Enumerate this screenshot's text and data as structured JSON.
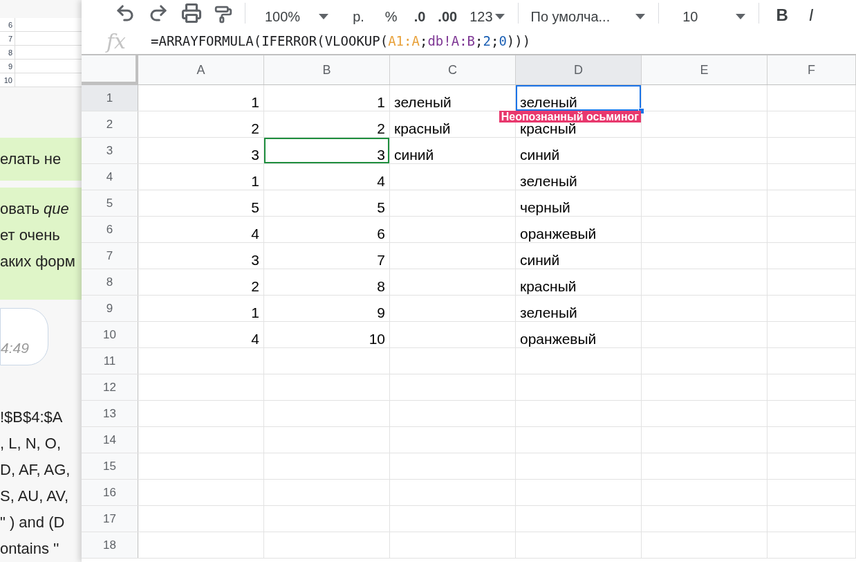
{
  "background_chat": {
    "mini_sheet_rows": [
      "6",
      "7",
      "8",
      "9",
      "10"
    ],
    "messages": [
      {
        "kind": "bubble",
        "lines": [
          "елать не"
        ]
      },
      {
        "kind": "bubble",
        "lines": [
          "овать *que*",
          "ет очень",
          "аких форм"
        ]
      },
      {
        "kind": "time",
        "lines": [
          "4:49"
        ]
      },
      {
        "kind": "plain",
        "lines": [
          "!$B$4:$A",
          ", L, N, O,",
          "D, AF, AG,",
          "S, AU, AV,",
          "\" ) and (D",
          "ontains ''"
        ]
      }
    ]
  },
  "toolbar": {
    "zoom": "100%",
    "currency": "р.",
    "percent": "%",
    "decimal_decrease": ".0",
    "decimal_increase": ".00",
    "number_format": "123",
    "font": "По умолча...",
    "font_size": "10",
    "bold": "B",
    "italic": "I"
  },
  "formula_bar": {
    "function_label": "fx",
    "segments": [
      {
        "text": "=ARRAYFORMULA(IFERROR(VLOOKUP(",
        "color": "#202124"
      },
      {
        "text": "A1:A",
        "color": "#e8a13a"
      },
      {
        "text": ";",
        "color": "#202124"
      },
      {
        "text": "db!A:B",
        "color": "#7e3794"
      },
      {
        "text": ";",
        "color": "#202124"
      },
      {
        "text": "2",
        "color": "#1a5fb4"
      },
      {
        "text": ";",
        "color": "#202124"
      },
      {
        "text": "0",
        "color": "#1a5fb4"
      },
      {
        "text": ")))",
        "color": "#202124"
      }
    ]
  },
  "columns": [
    {
      "label": "A",
      "selected": false,
      "kind": "number"
    },
    {
      "label": "B",
      "selected": false,
      "kind": "number"
    },
    {
      "label": "C",
      "selected": false,
      "kind": "text"
    },
    {
      "label": "D",
      "selected": true,
      "kind": "text"
    },
    {
      "label": "E",
      "selected": false,
      "kind": "text"
    },
    {
      "label": "F",
      "selected": false,
      "kind": "text"
    }
  ],
  "collaborator_label": "Неопознанный осьминог",
  "rows": [
    {
      "label": "1",
      "selected": true,
      "cells": [
        {
          "text": "1",
          "selected": false,
          "peer_cursor": false
        },
        {
          "text": "1",
          "selected": false,
          "peer_cursor": false
        },
        {
          "text": "зеленый",
          "selected": false,
          "peer_cursor": false
        },
        {
          "text": "зеленый",
          "selected": true,
          "peer_cursor": false
        }
      ]
    },
    {
      "label": "2",
      "selected": false,
      "cells": [
        {
          "text": "2",
          "selected": false,
          "peer_cursor": false
        },
        {
          "text": "2",
          "selected": false,
          "peer_cursor": false
        },
        {
          "text": "красный",
          "selected": false,
          "peer_cursor": false
        },
        {
          "text": "красный",
          "selected": false,
          "peer_cursor": false
        }
      ]
    },
    {
      "label": "3",
      "selected": false,
      "cells": [
        {
          "text": "3",
          "selected": false,
          "peer_cursor": false
        },
        {
          "text": "3",
          "selected": false,
          "peer_cursor": true
        },
        {
          "text": "синий",
          "selected": false,
          "peer_cursor": false
        },
        {
          "text": "синий",
          "selected": false,
          "peer_cursor": false
        }
      ]
    },
    {
      "label": "4",
      "selected": false,
      "cells": [
        {
          "text": "1",
          "selected": false,
          "peer_cursor": false
        },
        {
          "text": "4",
          "selected": false,
          "peer_cursor": false
        },
        {
          "selected": false,
          "peer_cursor": false
        },
        {
          "text": "зеленый",
          "selected": false,
          "peer_cursor": false
        }
      ]
    },
    {
      "label": "5",
      "selected": false,
      "cells": [
        {
          "text": "5",
          "selected": false,
          "peer_cursor": false
        },
        {
          "text": "5",
          "selected": false,
          "peer_cursor": false
        },
        {
          "selected": false,
          "peer_cursor": false
        },
        {
          "text": "черный",
          "selected": false,
          "peer_cursor": false
        }
      ]
    },
    {
      "label": "6",
      "selected": false,
      "cells": [
        {
          "text": "4",
          "selected": false,
          "peer_cursor": false
        },
        {
          "text": "6",
          "selected": false,
          "peer_cursor": false
        },
        {
          "selected": false,
          "peer_cursor": false
        },
        {
          "text": "оранжевый",
          "selected": false,
          "peer_cursor": false
        }
      ]
    },
    {
      "label": "7",
      "selected": false,
      "cells": [
        {
          "text": "3",
          "selected": false,
          "peer_cursor": false
        },
        {
          "text": "7",
          "selected": false,
          "peer_cursor": false
        },
        {
          "selected": false,
          "peer_cursor": false
        },
        {
          "text": "синий",
          "selected": false,
          "peer_cursor": false
        }
      ]
    },
    {
      "label": "8",
      "selected": false,
      "cells": [
        {
          "text": "2",
          "selected": false,
          "peer_cursor": false
        },
        {
          "text": "8",
          "selected": false,
          "peer_cursor": false
        },
        {
          "selected": false,
          "peer_cursor": false
        },
        {
          "text": "красный",
          "selected": false,
          "peer_cursor": false
        }
      ]
    },
    {
      "label": "9",
      "selected": false,
      "cells": [
        {
          "text": "1",
          "selected": false,
          "peer_cursor": false
        },
        {
          "text": "9",
          "selected": false,
          "peer_cursor": false
        },
        {
          "selected": false,
          "peer_cursor": false
        },
        {
          "text": "зеленый",
          "selected": false,
          "peer_cursor": false
        }
      ]
    },
    {
      "label": "10",
      "selected": false,
      "cells": [
        {
          "text": "4",
          "selected": false,
          "peer_cursor": false
        },
        {
          "text": "10",
          "selected": false,
          "peer_cursor": false
        },
        {
          "selected": false,
          "peer_cursor": false
        },
        {
          "text": "оранжевый",
          "selected": false,
          "peer_cursor": false
        }
      ]
    },
    {
      "label": "11",
      "selected": false
    },
    {
      "label": "12",
      "selected": false
    },
    {
      "label": "13",
      "selected": false
    },
    {
      "label": "14",
      "selected": false
    },
    {
      "label": "15",
      "selected": false
    },
    {
      "label": "16",
      "selected": false
    },
    {
      "label": "17",
      "selected": false
    },
    {
      "label": "18",
      "selected": false
    }
  ]
}
